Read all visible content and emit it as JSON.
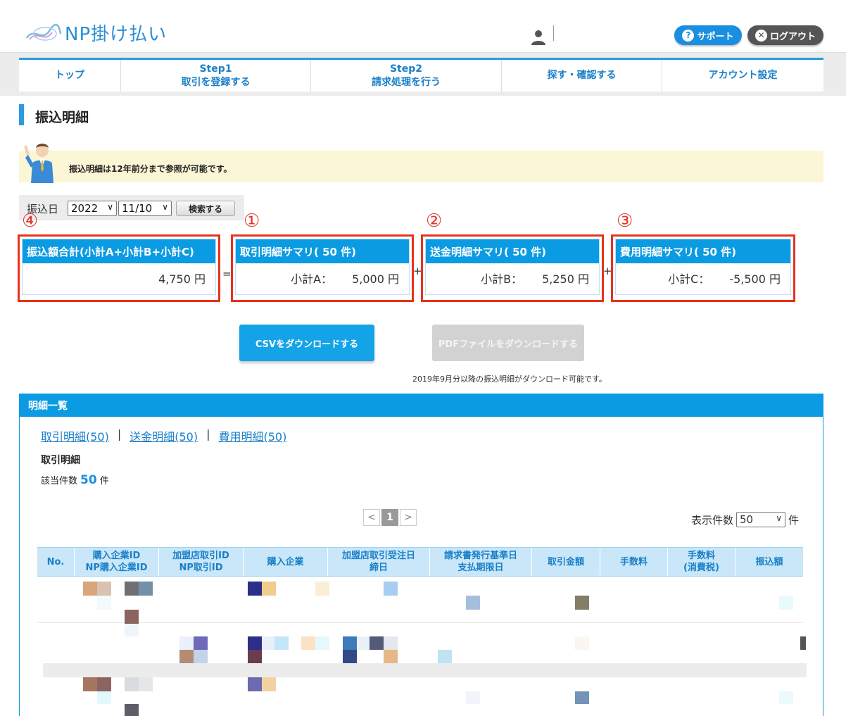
{
  "header": {
    "logo_text": "NP掛け払い",
    "support_label": "サポート",
    "logout_label": "ログアウト"
  },
  "nav": {
    "items": [
      {
        "line1": "トップ",
        "line2": ""
      },
      {
        "line1": "Step1",
        "line2": "取引を登録する"
      },
      {
        "line1": "Step2",
        "line2": "請求処理を行う"
      },
      {
        "line1": "探す・確認する",
        "line2": ""
      },
      {
        "line1": "アカウント設定",
        "line2": ""
      }
    ]
  },
  "page": {
    "title": "振込明細",
    "notice": "振込明細は12年前分まで参照が可能です。"
  },
  "filter": {
    "label": "振込日",
    "year": "2022",
    "date": "11/10",
    "search_label": "検索する"
  },
  "summary": {
    "total": {
      "marker": "④",
      "title": "振込額合計(小計A+小計B+小計C)",
      "value": "4,750 円"
    },
    "eq": "=",
    "plus": "+",
    "cards": [
      {
        "marker": "①",
        "title": "取引明細サマリ( 50 件)",
        "label": "小計A：",
        "value": "5,000 円"
      },
      {
        "marker": "②",
        "title": "送金明細サマリ( 50 件)",
        "label": "小計B：",
        "value": "5,250 円"
      },
      {
        "marker": "③",
        "title": "費用明細サマリ( 50 件)",
        "label": "小計C：",
        "value": "-5,500 円"
      }
    ]
  },
  "downloads": {
    "csv_label": "CSVをダウンロードする",
    "pdf_label": "PDFファイルをダウンロードする",
    "note": "2019年9月分以降の振込明細がダウンロード可能です。"
  },
  "detail": {
    "panel_title": "明細一覧",
    "links": [
      "取引明細(50)",
      "送金明細(50)",
      "費用明細(50)"
    ],
    "link_sep": "|",
    "sub_title": "取引明細",
    "count_label": "該当件数",
    "count_value": "50",
    "count_unit": "件",
    "pager": {
      "prev": "<",
      "current": "1",
      "next": ">"
    },
    "perpage_label": "表示件数",
    "perpage_value": "50",
    "perpage_unit": "件",
    "columns": [
      {
        "l1": "No.",
        "l2": ""
      },
      {
        "l1": "購入企業ID",
        "l2": "NP購入企業ID"
      },
      {
        "l1": "加盟店取引ID",
        "l2": "NP取引ID"
      },
      {
        "l1": "購入企業",
        "l2": ""
      },
      {
        "l1": "加盟店取引受注日",
        "l2": "締日"
      },
      {
        "l1": "請求書発行基準日",
        "l2": "支払期限日"
      },
      {
        "l1": "取引金額",
        "l2": ""
      },
      {
        "l1": "手数料",
        "l2": ""
      },
      {
        "l1": "手数料",
        "l2": "(消費税)"
      },
      {
        "l1": "振込額",
        "l2": ""
      }
    ]
  },
  "colors": {
    "accent": "#0a9be3",
    "marker_red": "#e8321c"
  }
}
